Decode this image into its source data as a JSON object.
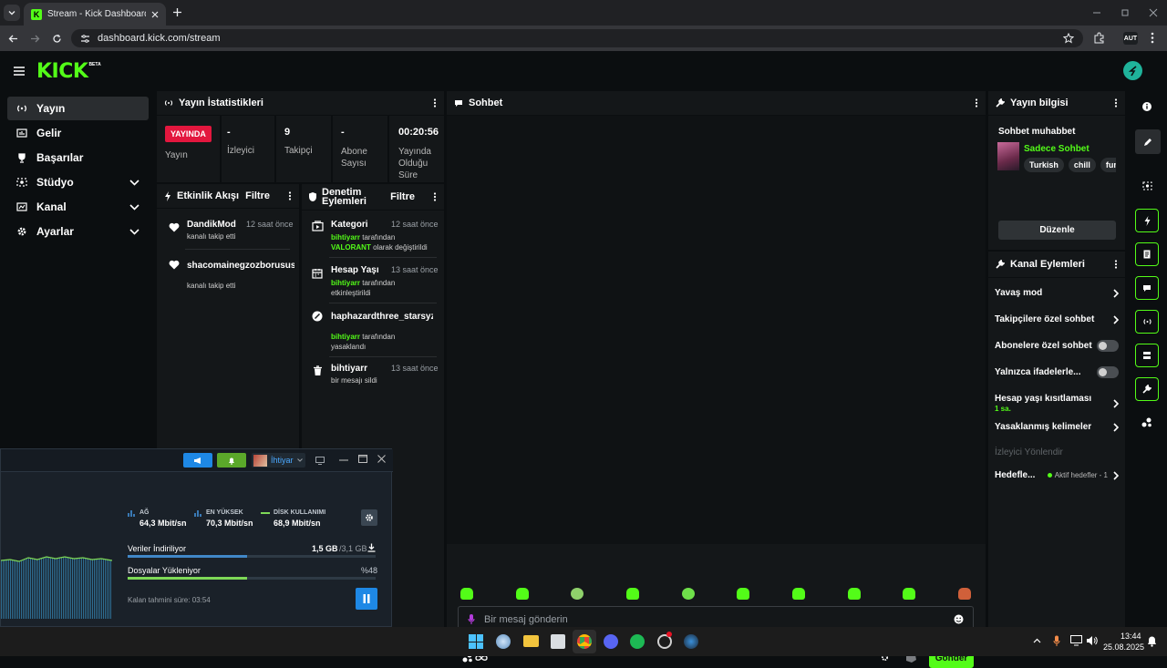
{
  "browser": {
    "tab_title": "Stream - Kick Dashboard",
    "url": "dashboard.kick.com/stream"
  },
  "brand": {
    "logo": "KICK",
    "badge": "BETA",
    "accent": "#53fc18"
  },
  "sidebar": {
    "items": [
      {
        "label": "Yayın",
        "icon": "broadcast-icon",
        "active": true
      },
      {
        "label": "Gelir",
        "icon": "money-icon"
      },
      {
        "label": "Başarılar",
        "icon": "trophy-icon"
      },
      {
        "label": "Stüdyo",
        "icon": "studio-icon",
        "expandable": true
      },
      {
        "label": "Kanal",
        "icon": "channel-icon",
        "expandable": true
      },
      {
        "label": "Ayarlar",
        "icon": "gear-icon",
        "expandable": true
      }
    ]
  },
  "stats": {
    "title": "Yayın İstatistikleri",
    "live_badge": "YAYINDA",
    "live_label": "Yayın",
    "viewers_value": "-",
    "viewers_label": "İzleyici",
    "followers_value": "9",
    "followers_label": "Takipçi",
    "subs_value": "-",
    "subs_label": "Abone Sayısı",
    "uptime_value": "00:20:56",
    "uptime_label": "Yayında Olduğu Süre"
  },
  "activity": {
    "title": "Etkinlik Akışı",
    "filter": "Filtre",
    "items": [
      {
        "user": "DandikMod",
        "time": "12 saat önce",
        "text": "kanalı takip etti"
      },
      {
        "user": "shacomainegzozborusus",
        "time": "",
        "text": "kanalı takip etti"
      }
    ]
  },
  "moderation": {
    "title": "Denetim Eylemleri",
    "filter": "Filtre",
    "items": [
      {
        "title": "Kategori",
        "time": "12 saat önce",
        "actor": "bihtiyarr",
        "line1": "tarafından",
        "highlight": "VALORANT",
        "line2": "olarak değiştirildi"
      },
      {
        "title": "Hesap Yaşı",
        "time": "13 saat önce",
        "actor": "bihtiyarr",
        "line1": "tarafından",
        "line2": "etkinleştirildi"
      },
      {
        "title": "haphazardthree_starsyz",
        "time": "",
        "actor": "bihtiyarr",
        "line1": "tarafından",
        "line2": "yasaklandı"
      },
      {
        "title": "bihtiyarr",
        "time": "13 saat önce",
        "line2": "bir mesajı sildi"
      }
    ]
  },
  "chat": {
    "title": "Sohbet",
    "placeholder": "Bir mesaj gönderin",
    "send": "Gönder",
    "emote_count": 10
  },
  "stream_info": {
    "title": "Yayın bilgisi",
    "stream_title": "Sohbet muhabbet",
    "category": "Sadece Sohbet",
    "tags": [
      "Turkish",
      "chill",
      "funny"
    ],
    "edit": "Düzenle"
  },
  "channel_actions": {
    "title": "Kanal Eylemleri",
    "items": [
      {
        "label": "Yavaş mod",
        "control": "arrow"
      },
      {
        "label": "Takipçilere özel sohbet",
        "control": "arrow"
      },
      {
        "label": "Abonelere özel sohbet",
        "control": "toggle"
      },
      {
        "label": "Yalnızca ifadelerle...",
        "control": "toggle"
      },
      {
        "label": "Hesap yaşı kısıtlaması",
        "sub": "1 sa.",
        "control": "arrow"
      },
      {
        "label": "Yasaklanmış kelimeler",
        "control": "arrow"
      },
      {
        "label": "İzleyici Yönlendir",
        "control": "none",
        "disabled": true
      },
      {
        "label": "Hedefle...",
        "sub_inline": "Aktif hedefler - 1",
        "control": "arrow"
      }
    ]
  },
  "download_widget": {
    "user": "İhtiyar",
    "net_label": "AĞ",
    "net_value": "64,3 Mbit/sn",
    "peak_label": "EN YÜKSEK",
    "peak_value": "70,3 Mbit/sn",
    "disk_label": "DİSK KULLANIMI",
    "disk_value": "68,9 Mbit/sn",
    "downloading_label": "Veriler İndiriliyor",
    "downloaded": "1,5 GB",
    "download_total": "/3,1 GB",
    "download_progress": 0.48,
    "uploading_label": "Dosyalar Yükleniyor",
    "upload_percent": "%48",
    "upload_progress": 0.48,
    "eta": "Kalan tahmini süre: 03:54"
  },
  "taskbar": {
    "time": "13:44",
    "date": "25.08.2025"
  }
}
